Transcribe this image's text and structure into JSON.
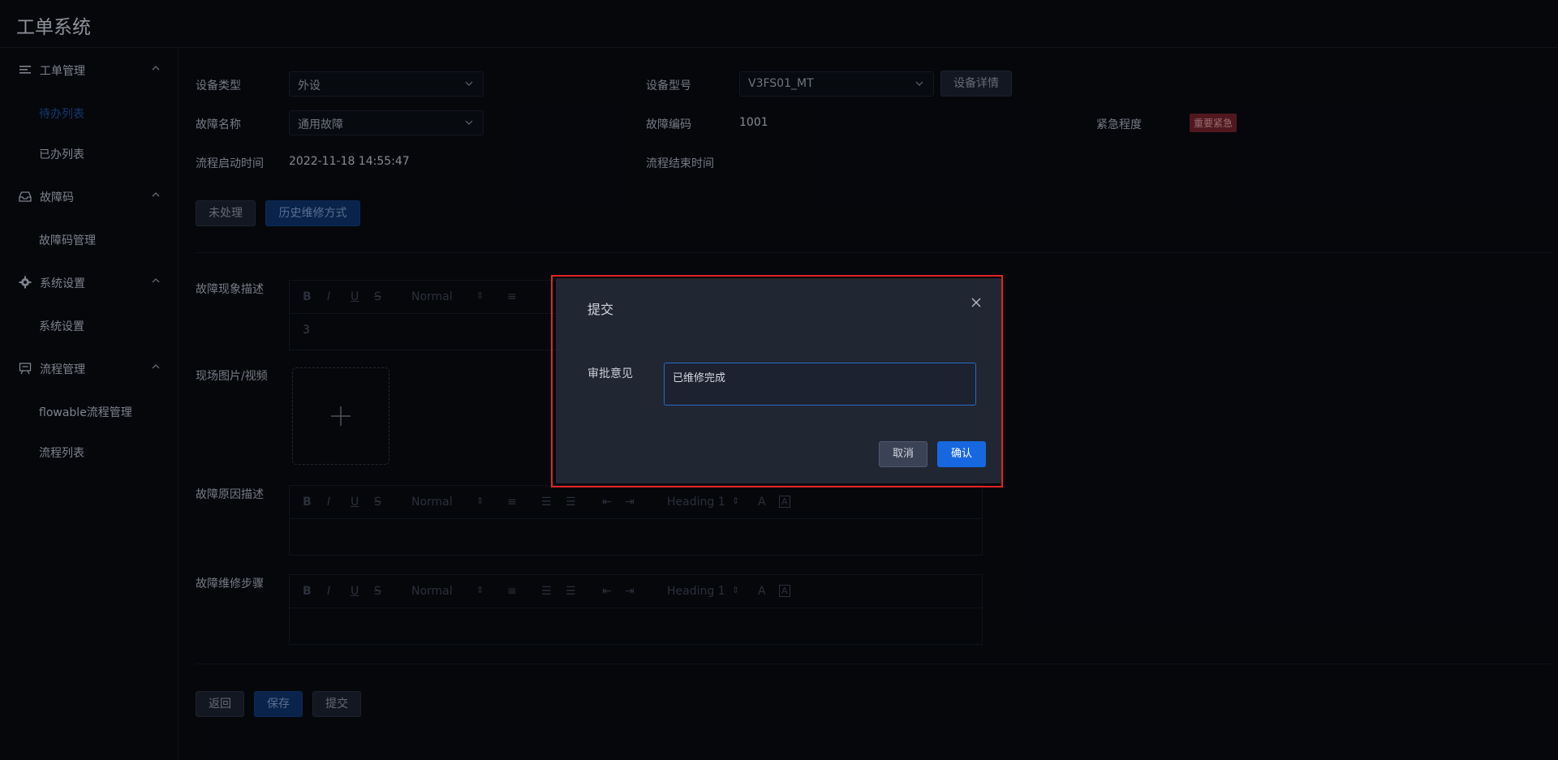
{
  "app": {
    "title": "工单系统"
  },
  "sidebar": {
    "groups": [
      {
        "label": "工单管理",
        "icon": "list-icon",
        "items": [
          "待办列表",
          "已办列表"
        ]
      },
      {
        "label": "故障码",
        "icon": "inbox-icon",
        "items": [
          "故障码管理"
        ]
      },
      {
        "label": "系统设置",
        "icon": "gear-icon",
        "items": [
          "系统设置"
        ]
      },
      {
        "label": "流程管理",
        "icon": "flow-icon",
        "items": [
          "flowable流程管理",
          "流程列表"
        ]
      }
    ]
  },
  "form": {
    "device_type_label": "设备类型",
    "device_type_value": "外设",
    "device_model_label": "设备型号",
    "device_model_value": "V3FS01_MT",
    "device_detail_button": "设备详情",
    "fault_name_label": "故障名称",
    "fault_name_value": "通用故障",
    "fault_code_label": "故障编码",
    "fault_code_value": "1001",
    "urgency_label": "紧急程度",
    "urgency_value": "重要紧急",
    "start_time_label": "流程启动时间",
    "start_time_value": "2022-11-18 14:55:47",
    "end_time_label": "流程结束时间",
    "tab_unprocessed": "未处理",
    "tab_history": "历史维修方式",
    "phenomenon_label": "故障现象描述",
    "phenomenon_text": "3",
    "media_label": "现场图片/视频",
    "cause_label": "故障原因描述",
    "steps_label": "故障维修步骤",
    "editor_format": "Normal",
    "editor_heading": "Heading 1",
    "back_button": "返回",
    "save_button": "保存",
    "submit_button": "提交"
  },
  "dialog": {
    "title": "提交",
    "opinion_label": "审批意见",
    "opinion_value": "已维修完成",
    "cancel_button": "取消",
    "confirm_button": "确认"
  },
  "colors": {
    "accent": "#1768e0",
    "highlight_border": "#e32424",
    "urgent_tag": "#70222a",
    "background": "#080a10"
  }
}
